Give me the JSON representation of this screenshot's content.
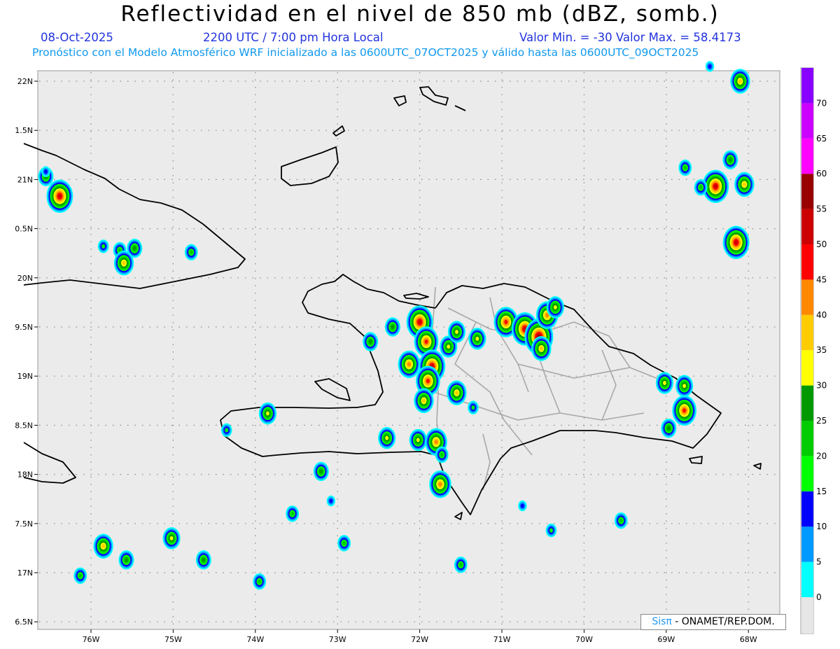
{
  "header": {
    "title": "Reflectividad en el nivel de 850 mb (dBZ, somb.)",
    "date": "08-Oct-2025",
    "time": "2200 UTC / 7:00 pm Hora Local",
    "min_max": "Valor Min. = -30  Valor Max. = 58.4173",
    "forecast_info": "Pronóstico con el Modelo Atmosférico WRF inicializado a las 0600UTC_07OCT2025 y válido hasta las  0600UTC_09OCT2025"
  },
  "map": {
    "lon_labels": [
      "76W",
      "75W",
      "74W",
      "73W",
      "72W",
      "71W",
      "70W",
      "69W",
      "68W"
    ],
    "lat_labels": [
      "22N",
      "1.5N",
      "21N",
      "0.5N",
      "20N",
      "9.5N",
      "19N",
      "8.5N",
      "18N",
      "7.5N",
      "17N",
      "6.5N"
    ],
    "background_color": "#ebebeb",
    "coastline_color": "#000000",
    "province_border_color": "#aaaaaa",
    "rain_cells": [
      {
        "lon": -76.38,
        "lat": 20.83,
        "dbz": 50
      },
      {
        "lon": -76.55,
        "lat": 21.03,
        "dbz": 25
      },
      {
        "lon": -76.55,
        "lat": 21.08,
        "dbz": 10
      },
      {
        "lon": -75.85,
        "lat": 20.32,
        "dbz": 15
      },
      {
        "lon": -75.65,
        "lat": 20.28,
        "dbz": 20
      },
      {
        "lon": -75.47,
        "lat": 20.3,
        "dbz": 25
      },
      {
        "lon": -75.6,
        "lat": 20.15,
        "dbz": 35
      },
      {
        "lon": -74.78,
        "lat": 20.26,
        "dbz": 20
      },
      {
        "lon": -72.0,
        "lat": 19.55,
        "dbz": 50
      },
      {
        "lon": -71.92,
        "lat": 19.35,
        "dbz": 45
      },
      {
        "lon": -71.85,
        "lat": 19.1,
        "dbz": 50
      },
      {
        "lon": -71.9,
        "lat": 18.95,
        "dbz": 45
      },
      {
        "lon": -72.13,
        "lat": 19.12,
        "dbz": 40
      },
      {
        "lon": -72.33,
        "lat": 19.5,
        "dbz": 25
      },
      {
        "lon": -71.95,
        "lat": 18.75,
        "dbz": 35
      },
      {
        "lon": -71.55,
        "lat": 18.83,
        "dbz": 35
      },
      {
        "lon": -71.65,
        "lat": 19.3,
        "dbz": 30
      },
      {
        "lon": -71.55,
        "lat": 19.45,
        "dbz": 30
      },
      {
        "lon": -71.3,
        "lat": 19.38,
        "dbz": 30
      },
      {
        "lon": -70.95,
        "lat": 19.55,
        "dbz": 45
      },
      {
        "lon": -70.72,
        "lat": 19.48,
        "dbz": 50
      },
      {
        "lon": -70.55,
        "lat": 19.4,
        "dbz": 55
      },
      {
        "lon": -70.45,
        "lat": 19.62,
        "dbz": 40
      },
      {
        "lon": -70.35,
        "lat": 19.7,
        "dbz": 30
      },
      {
        "lon": -70.52,
        "lat": 19.28,
        "dbz": 35
      },
      {
        "lon": -72.4,
        "lat": 18.37,
        "dbz": 30
      },
      {
        "lon": -72.02,
        "lat": 18.35,
        "dbz": 30
      },
      {
        "lon": -71.8,
        "lat": 18.33,
        "dbz": 40
      },
      {
        "lon": -71.73,
        "lat": 18.2,
        "dbz": 20
      },
      {
        "lon": -71.75,
        "lat": 17.9,
        "dbz": 40
      },
      {
        "lon": -73.85,
        "lat": 18.62,
        "dbz": 30
      },
      {
        "lon": -74.35,
        "lat": 18.45,
        "dbz": 15
      },
      {
        "lon": -69.02,
        "lat": 18.93,
        "dbz": 30
      },
      {
        "lon": -68.78,
        "lat": 18.65,
        "dbz": 45
      },
      {
        "lon": -68.78,
        "lat": 18.9,
        "dbz": 30
      },
      {
        "lon": -68.97,
        "lat": 18.47,
        "dbz": 25
      },
      {
        "lon": -68.1,
        "lat": 22.0,
        "dbz": 35
      },
      {
        "lon": -68.22,
        "lat": 21.2,
        "dbz": 25
      },
      {
        "lon": -68.4,
        "lat": 20.93,
        "dbz": 50
      },
      {
        "lon": -68.05,
        "lat": 20.95,
        "dbz": 35
      },
      {
        "lon": -68.15,
        "lat": 20.36,
        "dbz": 50
      },
      {
        "lon": -68.77,
        "lat": 21.12,
        "dbz": 20
      },
      {
        "lon": -68.58,
        "lat": 20.92,
        "dbz": 20
      },
      {
        "lon": -73.2,
        "lat": 18.03,
        "dbz": 25
      },
      {
        "lon": -73.55,
        "lat": 17.6,
        "dbz": 20
      },
      {
        "lon": -73.08,
        "lat": 17.73,
        "dbz": 10
      },
      {
        "lon": -72.92,
        "lat": 17.3,
        "dbz": 20
      },
      {
        "lon": -75.02,
        "lat": 17.35,
        "dbz": 30
      },
      {
        "lon": -75.57,
        "lat": 17.13,
        "dbz": 25
      },
      {
        "lon": -75.85,
        "lat": 17.27,
        "dbz": 35
      },
      {
        "lon": -74.63,
        "lat": 17.13,
        "dbz": 25
      },
      {
        "lon": -76.13,
        "lat": 16.97,
        "dbz": 20
      },
      {
        "lon": -73.95,
        "lat": 16.91,
        "dbz": 20
      },
      {
        "lon": -71.5,
        "lat": 17.08,
        "dbz": 20
      },
      {
        "lon": -70.75,
        "lat": 17.68,
        "dbz": 10
      },
      {
        "lon": -70.4,
        "lat": 17.43,
        "dbz": 15
      },
      {
        "lon": -69.55,
        "lat": 17.53,
        "dbz": 20
      },
      {
        "lon": -68.47,
        "lat": 22.15,
        "dbz": 10
      },
      {
        "lon": -72.6,
        "lat": 19.35,
        "dbz": 25
      },
      {
        "lon": -71.35,
        "lat": 18.68,
        "dbz": 15
      }
    ]
  },
  "colorbar": {
    "labels": [
      "0",
      "5",
      "10",
      "15",
      "20",
      "25",
      "30",
      "35",
      "40",
      "45",
      "50",
      "55",
      "60",
      "65",
      "70"
    ],
    "colors": [
      "#00ffff",
      "#0099ff",
      "#0000ff",
      "#00ff00",
      "#00cc00",
      "#009900",
      "#ffff00",
      "#ffcc00",
      "#ff8800",
      "#ff0000",
      "#cc0000",
      "#990000",
      "#ff00ff",
      "#cc00ff",
      "#8800ff"
    ]
  },
  "credit": {
    "sis": "Sisπ",
    "text": "- ONAMET/REP.DOM."
  }
}
